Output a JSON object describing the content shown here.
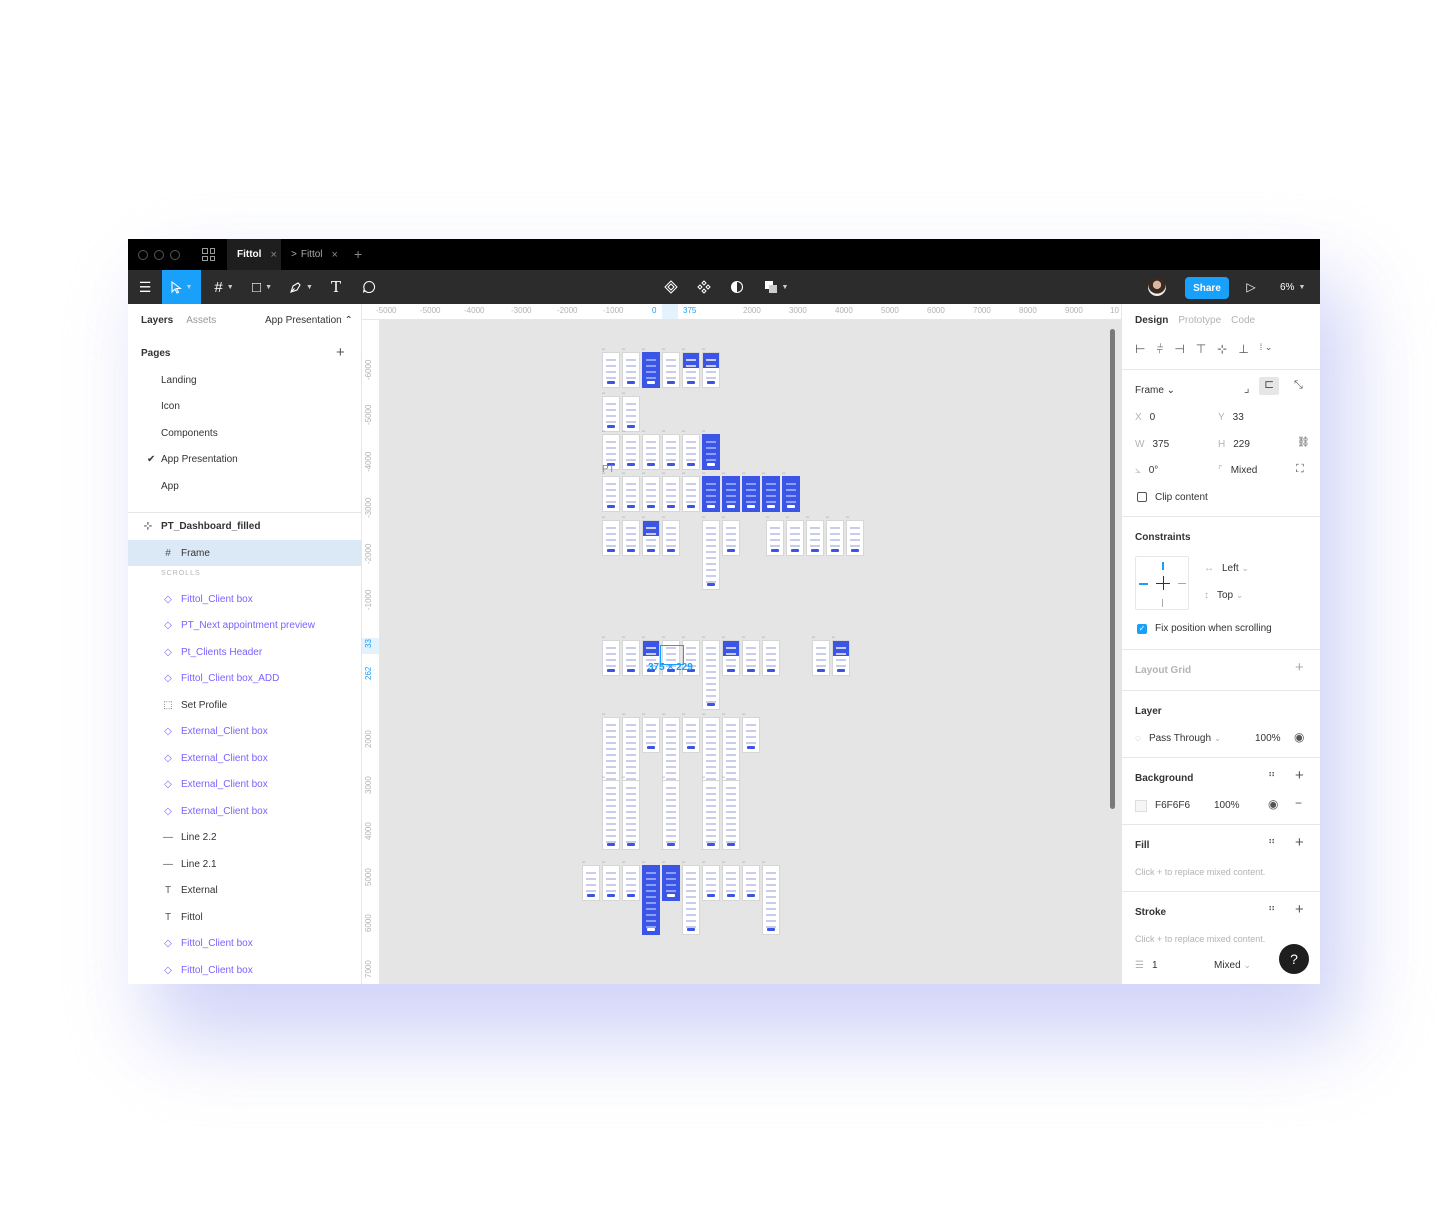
{
  "titlebar": {
    "tabs": [
      {
        "label": "Fittol",
        "close": "×",
        "active": true
      },
      {
        "label": "Fittol",
        "close": "×",
        "prefix": ">",
        "active": false
      }
    ],
    "new_tab": "+"
  },
  "toolbar": {
    "menu": "☰",
    "move_tool": "move",
    "frame_tool": "#",
    "shape_tool": "□",
    "pen_tool": "pen",
    "text_tool": "T",
    "comment_tool": "comment",
    "share_label": "Share",
    "present": "▷",
    "zoom": "6%"
  },
  "left_panel": {
    "tabs": [
      "Layers",
      "Assets"
    ],
    "page_selector": "App Presentation ⌃",
    "pages_heading": "Pages",
    "pages": [
      {
        "label": "Landing",
        "current": false
      },
      {
        "label": "Icon",
        "current": false
      },
      {
        "label": "Components",
        "current": false
      },
      {
        "label": "App Presentation",
        "current": true
      },
      {
        "label": "App",
        "current": false
      }
    ],
    "layers": [
      {
        "label": "PT_Dashboard_filled",
        "icon": "⊹",
        "type": "frame-parent"
      },
      {
        "label": "Frame",
        "icon": "#",
        "type": "frame",
        "selected": true
      },
      {
        "label": "SCROLLS",
        "type": "section"
      },
      {
        "label": "Fittol_Client box",
        "icon": "◇",
        "type": "component"
      },
      {
        "label": "PT_Next appointment preview",
        "icon": "◇",
        "type": "component"
      },
      {
        "label": "Pt_Clients Header",
        "icon": "◇",
        "type": "component"
      },
      {
        "label": "Fittol_Client box_ADD",
        "icon": "◇",
        "type": "component"
      },
      {
        "label": "Set Profile",
        "icon": "⬚",
        "type": "group"
      },
      {
        "label": "External_Client box",
        "icon": "◇",
        "type": "component"
      },
      {
        "label": "External_Client box",
        "icon": "◇",
        "type": "component"
      },
      {
        "label": "External_Client box",
        "icon": "◇",
        "type": "component"
      },
      {
        "label": "External_Client box",
        "icon": "◇",
        "type": "component"
      },
      {
        "label": "Line 2.2",
        "icon": "—",
        "type": "line"
      },
      {
        "label": "Line 2.1",
        "icon": "—",
        "type": "line"
      },
      {
        "label": "External",
        "icon": "T",
        "type": "text"
      },
      {
        "label": "Fittol",
        "icon": "T",
        "type": "text"
      },
      {
        "label": "Fittol_Client box",
        "icon": "◇",
        "type": "component"
      },
      {
        "label": "Fittol_Client box",
        "icon": "◇",
        "type": "component"
      }
    ]
  },
  "rulers": {
    "top": [
      "-5000",
      "-5000",
      "-4000",
      "-3000",
      "-2000",
      "-1000",
      "0",
      "375",
      "2000",
      "3000",
      "4000",
      "5000",
      "6000",
      "7000",
      "8000",
      "9000",
      "10"
    ],
    "left": [
      "-6000",
      "-5000",
      "-4000",
      "-3000",
      "-2000",
      "-1000",
      "33",
      "262",
      "2000",
      "3000",
      "4000",
      "5000",
      "6000",
      "7000"
    ]
  },
  "canvas": {
    "selection_label": "375 × 229",
    "pt_label": "PT"
  },
  "right_panel": {
    "tabs": [
      "Design",
      "Prototype",
      "Code"
    ],
    "frame_label": "Frame ⌄",
    "x_label": "X",
    "x": "0",
    "y_label": "Y",
    "y": "33",
    "w_label": "W",
    "w": "375",
    "h_label": "H",
    "h": "229",
    "rotation_label": "⦣",
    "rotation": "0°",
    "radius_label": "⌜",
    "radius": "Mixed",
    "clip_content": "Clip content",
    "constraints_heading": "Constraints",
    "constraint_h": "Left",
    "constraint_v": "Top",
    "fix_position": "Fix position when scrolling",
    "layout_grid_heading": "Layout Grid",
    "layer_heading": "Layer",
    "blend_mode": "Pass Through",
    "layer_opacity": "100%",
    "background_heading": "Background",
    "bg_hex": "F6F6F6",
    "bg_opacity": "100%",
    "fill_heading": "Fill",
    "fill_hint": "Click + to replace mixed content.",
    "stroke_heading": "Stroke",
    "stroke_hint": "Click + to replace mixed content.",
    "stroke_weight": "1",
    "stroke_style": "Mixed"
  },
  "help": "?",
  "colors": {
    "accent": "#18a0fb",
    "thumb_blue": "#3b55e6",
    "component": "#7b61ff"
  }
}
